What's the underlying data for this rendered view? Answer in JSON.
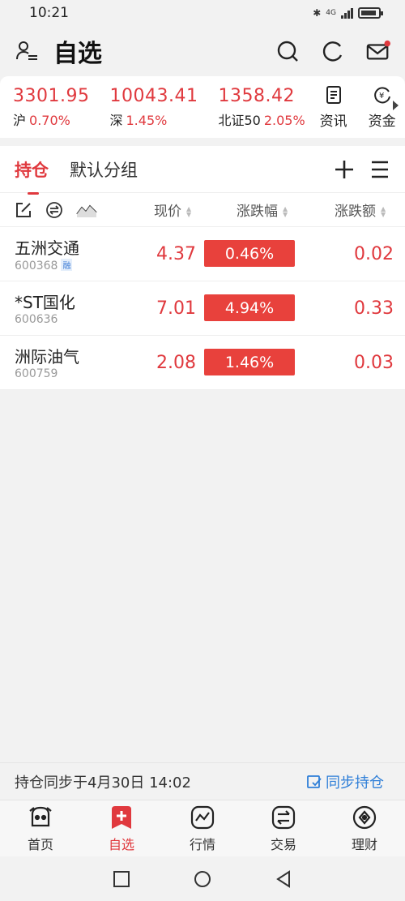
{
  "status_bar": {
    "time": "10:21",
    "network": "4G"
  },
  "header": {
    "title": "自选"
  },
  "indices": [
    {
      "value": "3301.95",
      "name": "沪",
      "pct": "0.70%"
    },
    {
      "value": "10043.41",
      "name": "深",
      "pct": "1.45%"
    },
    {
      "value": "1358.42",
      "name": "北证50",
      "pct": "2.05%"
    }
  ],
  "quick_links": {
    "news": "资讯",
    "funds": "资金"
  },
  "tabs": {
    "holdings": "持仓",
    "default_group": "默认分组"
  },
  "columns": {
    "price": "现价",
    "pct": "涨跌幅",
    "change": "涨跌额"
  },
  "stocks": [
    {
      "name": "五洲交通",
      "code": "600368",
      "badge": "融",
      "price": "4.37",
      "pct": "0.46%",
      "change": "0.02"
    },
    {
      "name": "*ST国化",
      "code": "600636",
      "badge": "",
      "price": "7.01",
      "pct": "4.94%",
      "change": "0.33"
    },
    {
      "name": "洲际油气",
      "code": "600759",
      "badge": "",
      "price": "2.08",
      "pct": "1.46%",
      "change": "0.03"
    }
  ],
  "sync": {
    "text": "持仓同步于4月30日 14:02",
    "button": "同步持仓"
  },
  "bottom_nav": {
    "home": "首页",
    "watchlist": "自选",
    "market": "行情",
    "trade": "交易",
    "wealth": "理财"
  },
  "colors": {
    "up_red": "#e0393e",
    "link_blue": "#2f7fd8"
  }
}
